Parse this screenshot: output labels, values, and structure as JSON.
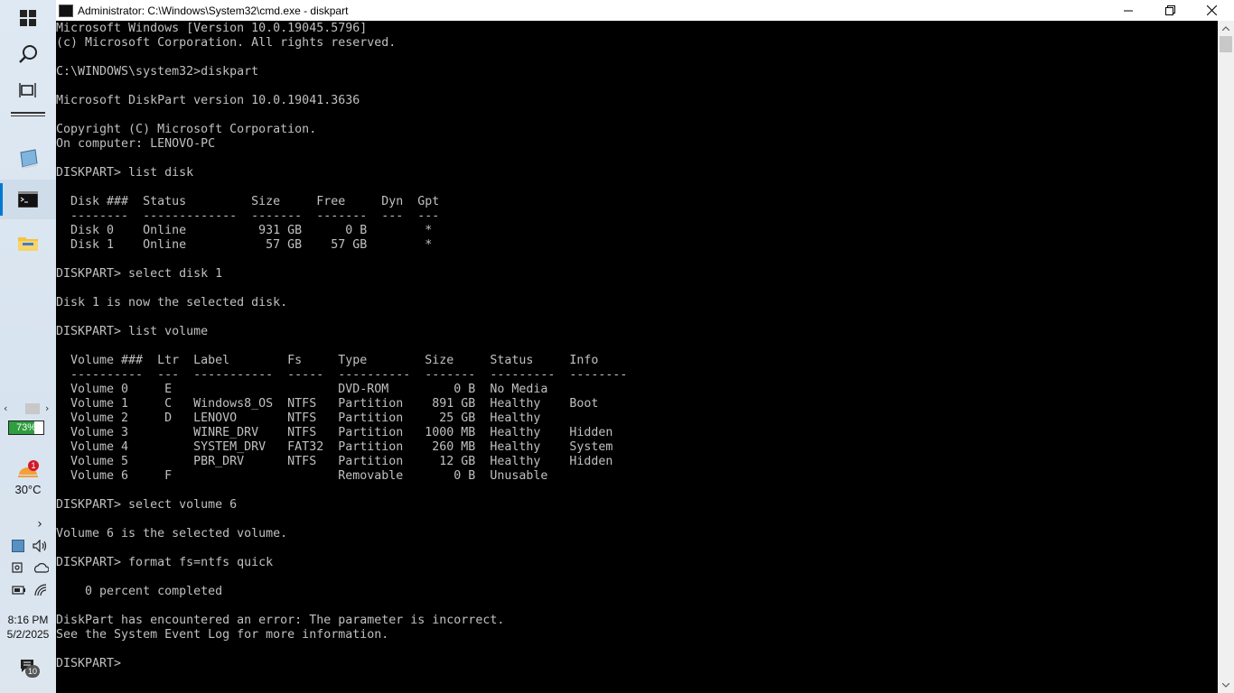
{
  "window": {
    "title": "Administrator: C:\\Windows\\System32\\cmd.exe - diskpart"
  },
  "console": {
    "lines": [
      "Microsoft Windows [Version 10.0.19045.5796]",
      "(c) Microsoft Corporation. All rights reserved.",
      "",
      "C:\\WINDOWS\\system32>diskpart",
      "",
      "Microsoft DiskPart version 10.0.19041.3636",
      "",
      "Copyright (C) Microsoft Corporation.",
      "On computer: LENOVO-PC",
      "",
      "DISKPART> list disk",
      "",
      "  Disk ###  Status         Size     Free     Dyn  Gpt",
      "  --------  -------------  -------  -------  ---  ---",
      "  Disk 0    Online          931 GB      0 B        *",
      "  Disk 1    Online           57 GB    57 GB        *",
      "",
      "DISKPART> select disk 1",
      "",
      "Disk 1 is now the selected disk.",
      "",
      "DISKPART> list volume",
      "",
      "  Volume ###  Ltr  Label        Fs     Type        Size     Status     Info",
      "  ----------  ---  -----------  -----  ----------  -------  ---------  --------",
      "  Volume 0     E                       DVD-ROM         0 B  No Media",
      "  Volume 1     C   Windows8_OS  NTFS   Partition    891 GB  Healthy    Boot",
      "  Volume 2     D   LENOVO       NTFS   Partition     25 GB  Healthy",
      "  Volume 3         WINRE_DRV    NTFS   Partition   1000 MB  Healthy    Hidden",
      "  Volume 4         SYSTEM_DRV   FAT32  Partition    260 MB  Healthy    System",
      "  Volume 5         PBR_DRV      NTFS   Partition     12 GB  Healthy    Hidden",
      "  Volume 6     F                       Removable       0 B  Unusable",
      "",
      "DISKPART> select volume 6",
      "",
      "Volume 6 is the selected volume.",
      "",
      "DISKPART> format fs=ntfs quick",
      "",
      "    0 percent completed",
      "",
      "DiskPart has encountered an error: The parameter is incorrect.",
      "See the System Event Log for more information.",
      "",
      "DISKPART> "
    ]
  },
  "taskbar": {
    "battery_percent": "73%",
    "weather_badge": "1",
    "temperature": "30°C",
    "time": "8:16 PM",
    "date": "5/2/2025",
    "notification_count": "10"
  },
  "colors": {
    "console_bg": "#000000",
    "console_fg": "#c0c0c0",
    "battery_green": "#2e9e3e",
    "accent": "#0078d4"
  }
}
